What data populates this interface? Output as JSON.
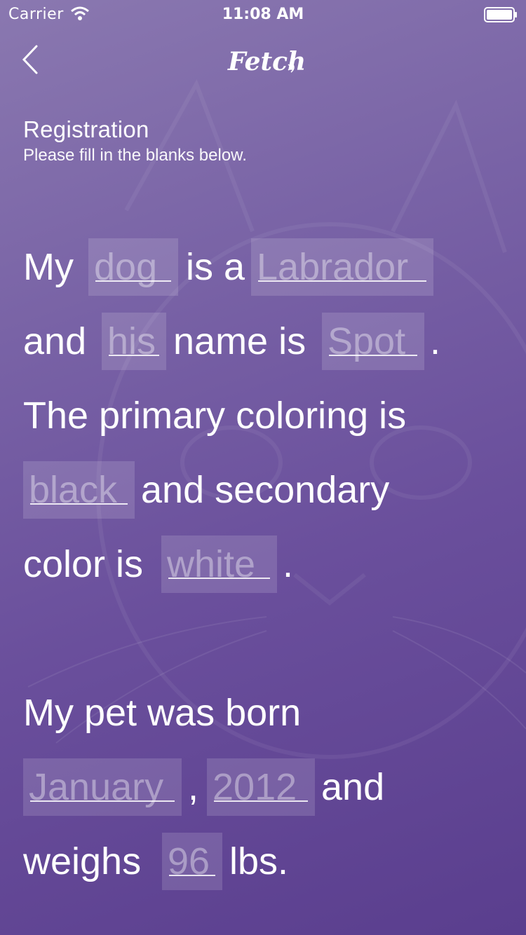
{
  "status_bar": {
    "carrier": "Carrier",
    "time": "11:08 AM",
    "icons": [
      "wifi-icon",
      "battery-icon"
    ]
  },
  "nav": {
    "back_icon": "chevron-left-icon",
    "logo_text": "Fetch"
  },
  "header": {
    "title": "Registration",
    "subtitle": "Please fill in the blanks below."
  },
  "form": {
    "line1": {
      "t1": "My",
      "blank_pet_type": "dog",
      "t2": "is a",
      "blank_breed": "Labrador"
    },
    "line2": {
      "t1": "and",
      "blank_pronoun": "his",
      "t2": "name is",
      "blank_name": "Spot",
      "t3": "."
    },
    "line3": {
      "t1": "The primary coloring is"
    },
    "line4": {
      "blank_primary_color": "black",
      "t1": "and secondary"
    },
    "line5": {
      "t1": "color is",
      "blank_secondary_color": "white",
      "t2": "."
    },
    "line6": {
      "t1": "My pet was born"
    },
    "line7": {
      "blank_month": "January",
      "t1": ",",
      "blank_year": "2012",
      "t2": "and"
    },
    "line8": {
      "t1": "weighs",
      "blank_weight": "96",
      "t2": "lbs."
    }
  },
  "colors": {
    "background_top": "#8a78b0",
    "background_bottom": "#5a3e8e",
    "text": "#ffffff"
  }
}
